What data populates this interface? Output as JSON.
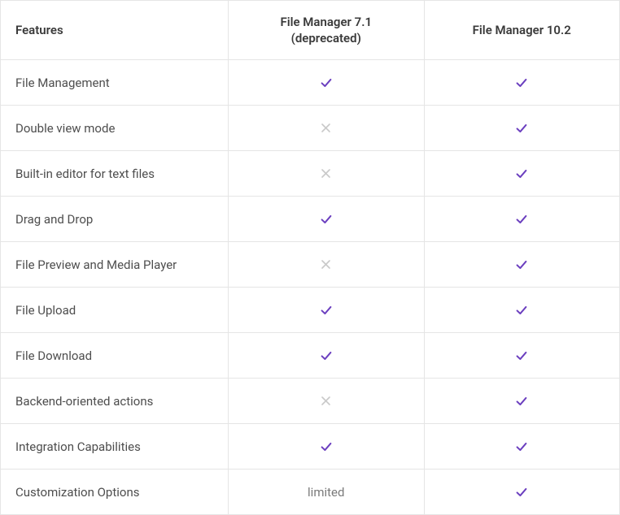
{
  "headers": {
    "features": "Features",
    "col_a_line1": "File Manager 7.1",
    "col_a_line2": "(deprecated)",
    "col_b": "File Manager 10.2"
  },
  "rows": [
    {
      "feature": "File Management",
      "a": "check",
      "b": "check"
    },
    {
      "feature": "Double view mode",
      "a": "cross",
      "b": "check"
    },
    {
      "feature": "Built-in editor for text files",
      "a": "cross",
      "b": "check"
    },
    {
      "feature": "Drag and Drop",
      "a": "check",
      "b": "check"
    },
    {
      "feature": "File Preview and Media Player",
      "a": "cross",
      "b": "check"
    },
    {
      "feature": "File Upload",
      "a": "check",
      "b": "check"
    },
    {
      "feature": "File Download",
      "a": "check",
      "b": "check"
    },
    {
      "feature": "Backend-oriented actions",
      "a": "cross",
      "b": "check"
    },
    {
      "feature": "Integration Capabilities",
      "a": "check",
      "b": "check"
    },
    {
      "feature": "Customization Options",
      "a": "limited",
      "b": "check"
    }
  ]
}
